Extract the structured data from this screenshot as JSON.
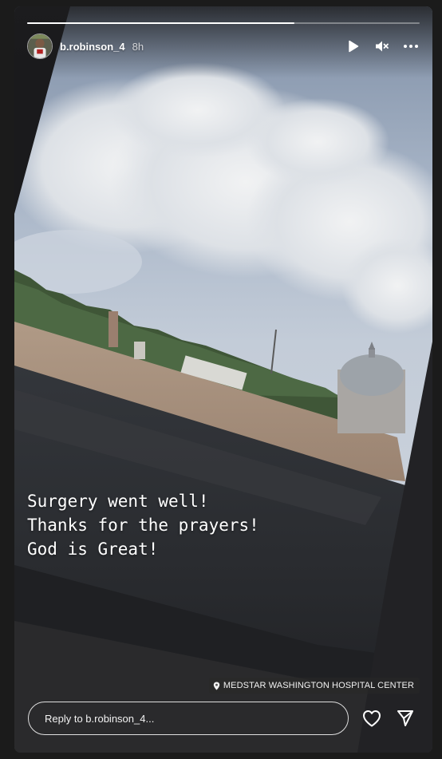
{
  "story": {
    "progress": 0.68,
    "username": "b.robinson_4",
    "time": "8h",
    "caption": "Surgery went well!\nThanks for the prayers!\nGod is Great!",
    "location": "MEDSTAR WASHINGTON HOSPITAL CENTER"
  },
  "icons": {
    "play": "play-icon",
    "mute": "muted-speaker-icon",
    "more": "more-horizontal-icon",
    "heart": "heart-icon",
    "send": "send-paper-plane-icon",
    "location": "location-pin-icon"
  },
  "reply": {
    "placeholder": "Reply to b.robinson_4..."
  },
  "colors": {
    "page_background": "#1b1b1b",
    "text": "#ffffff"
  }
}
